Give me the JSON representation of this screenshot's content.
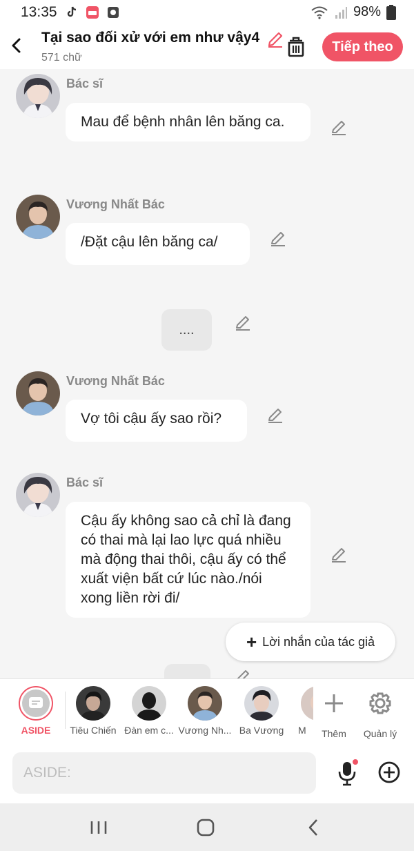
{
  "status": {
    "time": "13:35",
    "battery": "98%"
  },
  "header": {
    "title": "Tại sao đối xử với em như vậy4",
    "subtitle": "571 chữ",
    "next_label": "Tiếp theo"
  },
  "messages": [
    {
      "name": "Bác sĩ",
      "text": "Mau để bệnh nhân lên băng ca."
    },
    {
      "name": "Vương Nhất Bác",
      "text": "/Đặt cậu lên băng ca/"
    },
    {
      "narration": "...."
    },
    {
      "name": "Vương Nhất Bác",
      "text": "Vợ tôi cậu ấy sao rồi?"
    },
    {
      "name": "Bác sĩ",
      "text": "Cậu ấy không sao cả chỉ là đang có thai mà lại lao lực quá nhiều mà động thai thôi, cậu ấy có thể xuất viện bất cứ lúc nào./nói xong liền rời đi/"
    }
  ],
  "author_note": {
    "label": "Lời nhắn của tác giả"
  },
  "characters": [
    {
      "label": "ASIDE"
    },
    {
      "label": "Tiêu Chiến"
    },
    {
      "label": "Đàn em c..."
    },
    {
      "label": "Vương Nh..."
    },
    {
      "label": "Ba Vương"
    },
    {
      "label": "M"
    },
    {
      "label": "Thêm"
    },
    {
      "label": "Quản lý"
    }
  ],
  "input": {
    "placeholder": "ASIDE:"
  },
  "colors": {
    "accent": "#f05466",
    "background": "#f5f5f5",
    "bubble": "#ffffff"
  }
}
